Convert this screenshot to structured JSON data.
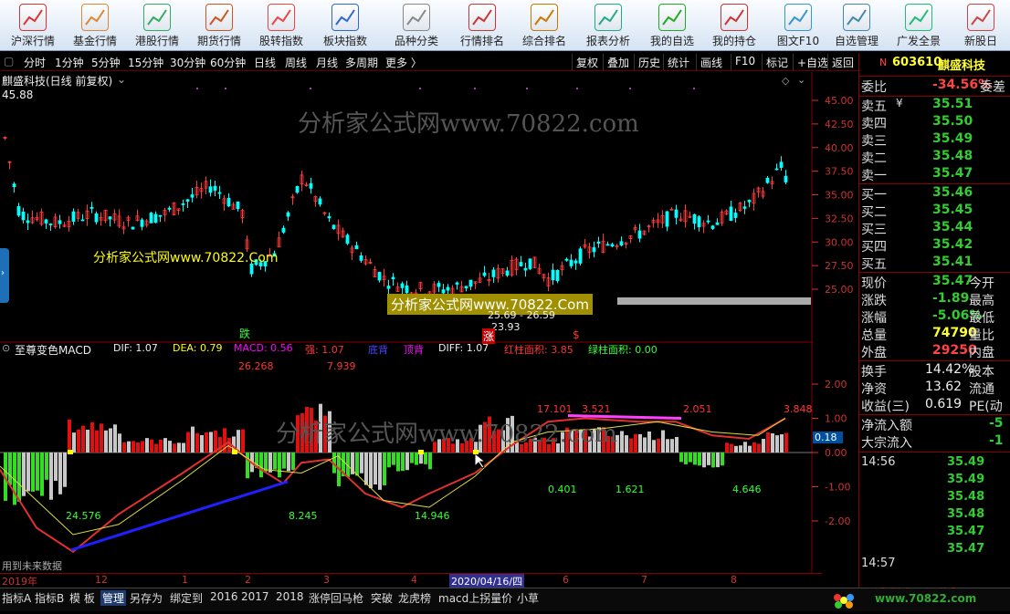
{
  "toolbar": {
    "items": [
      "沪深行情",
      "基金行情",
      "港股行情",
      "期货行情",
      "股转指数",
      "板块指数",
      "品种分类",
      "行情排名",
      "综合排名",
      "报表分析",
      "我的自选",
      "我的持仓",
      "图文F10",
      "自选管理",
      "广发全景",
      "新股日"
    ]
  },
  "periods": {
    "items": [
      "分时",
      "1分钟",
      "5分钟",
      "15分钟",
      "30分钟",
      "60分钟",
      "日线",
      "周线",
      "月线",
      "多周期",
      "更多 〉"
    ]
  },
  "actions": {
    "items": [
      "复权",
      "叠加",
      "历史",
      "统计",
      "画线",
      "F10",
      "标记",
      "+自选",
      "返回"
    ]
  },
  "chart_header": {
    "title": "麒盛科技(日线 前复权)",
    "high_label": "45.88"
  },
  "watermark": {
    "text": "分析家公式网www.70822.com"
  },
  "ad": {
    "left": "分析家公式网www.70822.Com",
    "box": "分析家公式网www.70822.Com"
  },
  "price_axis": [
    "45.00",
    "42.50",
    "40.00",
    "37.50",
    "35.00",
    "32.50",
    "30.00",
    "27.50",
    "25.00"
  ],
  "price_notes": {
    "range": "25.69 - 26.59",
    "low": "23.93",
    "die": "跌",
    "zhang": "涨",
    "s": "$"
  },
  "indicator": {
    "name": "至尊变色MACD",
    "dif": "DIF: 1.07",
    "dea": "DEA: 0.79",
    "macd": "MACD: 0.56",
    "qiang": "强: 1.07",
    "dibei": "底背",
    "dingbei": "顶背",
    "diff": "DIFF: 1.07",
    "red_area": "红柱面积: 3.85",
    "green_area": "绿柱面积: 0.00"
  },
  "macd_axis": [
    "2.00",
    "1.00",
    "0.00",
    "-1.00",
    "-2.00"
  ],
  "macd_labels": {
    "a": "26.268",
    "b": "7.939",
    "c": "17.101",
    "d": "3.521",
    "e": "2.051",
    "f": "3.848",
    "g": "24.576",
    "h": "8.245",
    "i": "14.946",
    "j": "0.401",
    "k": "1.621",
    "l": "4.646",
    "cur": "0.18",
    "future": "用到未来数据"
  },
  "dates": {
    "y2019": "2019年",
    "m12": "12",
    "m1": "1",
    "m2": "2",
    "m3": "3",
    "m4": "4",
    "cur": "2020/04/16/四",
    "m6": "6",
    "m7": "7",
    "m8": "8"
  },
  "bottom": {
    "items": [
      "指标A",
      "指标B",
      "模 板",
      "管理",
      "另存为",
      "绑定到",
      "2016",
      "2017",
      "2018",
      "涨停回马枪",
      "突破",
      "龙虎榜",
      "macd上拐量价",
      "小草"
    ],
    "logo": "分析家公式网",
    "url": "www.70822.com"
  },
  "stock": {
    "code": "603610",
    "name": "麒盛科技",
    "weibi_l": "委比",
    "weibi": "-34.56%",
    "weicha_l": "委差"
  },
  "asks": [
    {
      "l": "卖五",
      "v": "35.51"
    },
    {
      "l": "卖四",
      "v": "35.50"
    },
    {
      "l": "卖三",
      "v": "35.49"
    },
    {
      "l": "卖二",
      "v": "35.48"
    },
    {
      "l": "卖一",
      "v": "35.47"
    }
  ],
  "bids": [
    {
      "l": "买一",
      "v": "35.46"
    },
    {
      "l": "买二",
      "v": "35.45"
    },
    {
      "l": "买三",
      "v": "35.44"
    },
    {
      "l": "买四",
      "v": "35.42"
    },
    {
      "l": "买五",
      "v": "35.41"
    }
  ],
  "quote": [
    {
      "l": "现价",
      "v": "35.47",
      "r": "今开"
    },
    {
      "l": "涨跌",
      "v": "-1.89",
      "r": "最高"
    },
    {
      "l": "涨幅",
      "v": "-5.06%",
      "r": "最低"
    },
    {
      "l": "总量",
      "v": "74790",
      "r": "量比"
    },
    {
      "l": "外盘",
      "v": "29250",
      "r": "内盘"
    }
  ],
  "extra": [
    {
      "l": "换手",
      "v": "14.42%",
      "r": "股本"
    },
    {
      "l": "净资",
      "v": "13.62",
      "r": "流通"
    },
    {
      "l": "收益(三)",
      "v": "0.619",
      "r": "PE(动"
    }
  ],
  "flow": [
    {
      "l": "净流入额",
      "v": "-5"
    },
    {
      "l": "大宗流入",
      "v": "-1"
    }
  ],
  "ticks": {
    "time": "14:56",
    "vals": [
      "35.49",
      "35.49",
      "35.48",
      "35.48",
      "35.47",
      "35.47"
    ],
    "time2": "14:57"
  },
  "colors": {
    "up": "#ff3c3c",
    "down": "#00ffff",
    "grid": "#800000"
  }
}
